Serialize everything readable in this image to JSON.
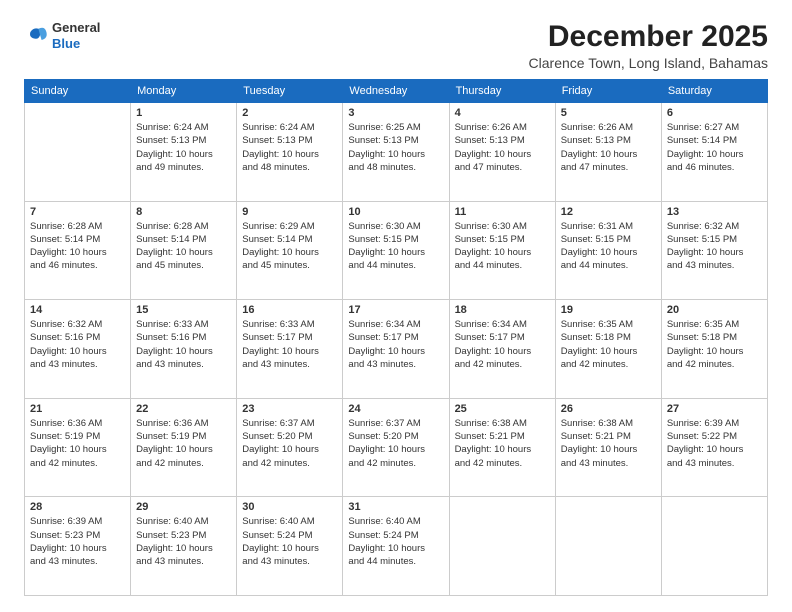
{
  "header": {
    "logo_line1": "General",
    "logo_line2": "Blue",
    "month": "December 2025",
    "location": "Clarence Town, Long Island, Bahamas"
  },
  "weekdays": [
    "Sunday",
    "Monday",
    "Tuesday",
    "Wednesday",
    "Thursday",
    "Friday",
    "Saturday"
  ],
  "weeks": [
    [
      {
        "day": "",
        "info": ""
      },
      {
        "day": "1",
        "info": "Sunrise: 6:24 AM\nSunset: 5:13 PM\nDaylight: 10 hours\nand 49 minutes."
      },
      {
        "day": "2",
        "info": "Sunrise: 6:24 AM\nSunset: 5:13 PM\nDaylight: 10 hours\nand 48 minutes."
      },
      {
        "day": "3",
        "info": "Sunrise: 6:25 AM\nSunset: 5:13 PM\nDaylight: 10 hours\nand 48 minutes."
      },
      {
        "day": "4",
        "info": "Sunrise: 6:26 AM\nSunset: 5:13 PM\nDaylight: 10 hours\nand 47 minutes."
      },
      {
        "day": "5",
        "info": "Sunrise: 6:26 AM\nSunset: 5:13 PM\nDaylight: 10 hours\nand 47 minutes."
      },
      {
        "day": "6",
        "info": "Sunrise: 6:27 AM\nSunset: 5:14 PM\nDaylight: 10 hours\nand 46 minutes."
      }
    ],
    [
      {
        "day": "7",
        "info": "Sunrise: 6:28 AM\nSunset: 5:14 PM\nDaylight: 10 hours\nand 46 minutes."
      },
      {
        "day": "8",
        "info": "Sunrise: 6:28 AM\nSunset: 5:14 PM\nDaylight: 10 hours\nand 45 minutes."
      },
      {
        "day": "9",
        "info": "Sunrise: 6:29 AM\nSunset: 5:14 PM\nDaylight: 10 hours\nand 45 minutes."
      },
      {
        "day": "10",
        "info": "Sunrise: 6:30 AM\nSunset: 5:15 PM\nDaylight: 10 hours\nand 44 minutes."
      },
      {
        "day": "11",
        "info": "Sunrise: 6:30 AM\nSunset: 5:15 PM\nDaylight: 10 hours\nand 44 minutes."
      },
      {
        "day": "12",
        "info": "Sunrise: 6:31 AM\nSunset: 5:15 PM\nDaylight: 10 hours\nand 44 minutes."
      },
      {
        "day": "13",
        "info": "Sunrise: 6:32 AM\nSunset: 5:15 PM\nDaylight: 10 hours\nand 43 minutes."
      }
    ],
    [
      {
        "day": "14",
        "info": "Sunrise: 6:32 AM\nSunset: 5:16 PM\nDaylight: 10 hours\nand 43 minutes."
      },
      {
        "day": "15",
        "info": "Sunrise: 6:33 AM\nSunset: 5:16 PM\nDaylight: 10 hours\nand 43 minutes."
      },
      {
        "day": "16",
        "info": "Sunrise: 6:33 AM\nSunset: 5:17 PM\nDaylight: 10 hours\nand 43 minutes."
      },
      {
        "day": "17",
        "info": "Sunrise: 6:34 AM\nSunset: 5:17 PM\nDaylight: 10 hours\nand 43 minutes."
      },
      {
        "day": "18",
        "info": "Sunrise: 6:34 AM\nSunset: 5:17 PM\nDaylight: 10 hours\nand 42 minutes."
      },
      {
        "day": "19",
        "info": "Sunrise: 6:35 AM\nSunset: 5:18 PM\nDaylight: 10 hours\nand 42 minutes."
      },
      {
        "day": "20",
        "info": "Sunrise: 6:35 AM\nSunset: 5:18 PM\nDaylight: 10 hours\nand 42 minutes."
      }
    ],
    [
      {
        "day": "21",
        "info": "Sunrise: 6:36 AM\nSunset: 5:19 PM\nDaylight: 10 hours\nand 42 minutes."
      },
      {
        "day": "22",
        "info": "Sunrise: 6:36 AM\nSunset: 5:19 PM\nDaylight: 10 hours\nand 42 minutes."
      },
      {
        "day": "23",
        "info": "Sunrise: 6:37 AM\nSunset: 5:20 PM\nDaylight: 10 hours\nand 42 minutes."
      },
      {
        "day": "24",
        "info": "Sunrise: 6:37 AM\nSunset: 5:20 PM\nDaylight: 10 hours\nand 42 minutes."
      },
      {
        "day": "25",
        "info": "Sunrise: 6:38 AM\nSunset: 5:21 PM\nDaylight: 10 hours\nand 42 minutes."
      },
      {
        "day": "26",
        "info": "Sunrise: 6:38 AM\nSunset: 5:21 PM\nDaylight: 10 hours\nand 43 minutes."
      },
      {
        "day": "27",
        "info": "Sunrise: 6:39 AM\nSunset: 5:22 PM\nDaylight: 10 hours\nand 43 minutes."
      }
    ],
    [
      {
        "day": "28",
        "info": "Sunrise: 6:39 AM\nSunset: 5:23 PM\nDaylight: 10 hours\nand 43 minutes."
      },
      {
        "day": "29",
        "info": "Sunrise: 6:40 AM\nSunset: 5:23 PM\nDaylight: 10 hours\nand 43 minutes."
      },
      {
        "day": "30",
        "info": "Sunrise: 6:40 AM\nSunset: 5:24 PM\nDaylight: 10 hours\nand 43 minutes."
      },
      {
        "day": "31",
        "info": "Sunrise: 6:40 AM\nSunset: 5:24 PM\nDaylight: 10 hours\nand 44 minutes."
      },
      {
        "day": "",
        "info": ""
      },
      {
        "day": "",
        "info": ""
      },
      {
        "day": "",
        "info": ""
      }
    ]
  ]
}
